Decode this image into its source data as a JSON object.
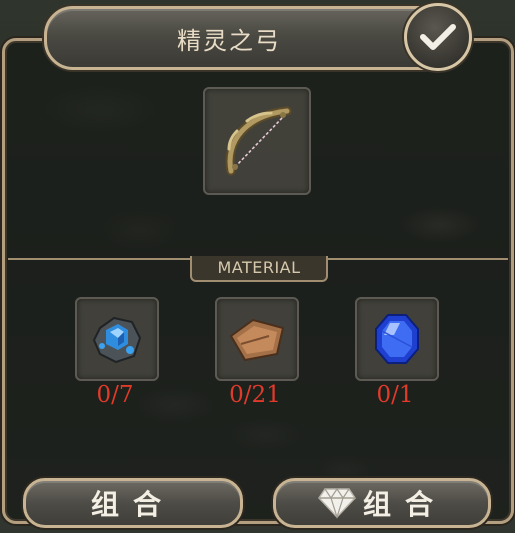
{
  "recipe": {
    "title": "精灵之弓",
    "result_item": "bow-icon"
  },
  "section_label": "MATERIAL",
  "materials": [
    {
      "icon": "blue-ore-icon",
      "count": "0/7"
    },
    {
      "icon": "leather-hide-icon",
      "count": "0/21"
    },
    {
      "icon": "sapphire-icon",
      "count": "0/1"
    }
  ],
  "buttons": {
    "combine_label": "组合",
    "gem_combine_label": "组合"
  },
  "colors": {
    "count_insufficient": "#e03a2a",
    "frame_gold": "#c8b493"
  }
}
